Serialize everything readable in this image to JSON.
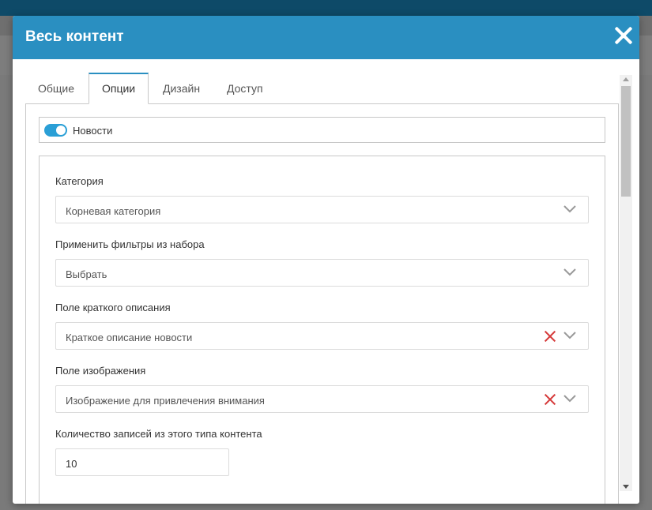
{
  "modal": {
    "title": "Весь контент"
  },
  "tabs": [
    {
      "label": "Общие",
      "active": false
    },
    {
      "label": "Опции",
      "active": true
    },
    {
      "label": "Дизайн",
      "active": false
    },
    {
      "label": "Доступ",
      "active": false
    }
  ],
  "toggle": {
    "label": "Новости",
    "checked": true
  },
  "fields": {
    "category": {
      "label": "Категория",
      "value": "Корневая категория"
    },
    "filters": {
      "label": "Применить фильтры из набора",
      "value": "Выбрать"
    },
    "summary": {
      "label": "Поле краткого описания",
      "value": "Краткое описание новости"
    },
    "image": {
      "label": "Поле изображения",
      "value": "Изображение для привлечения внимания"
    },
    "count": {
      "label": "Количество записей из этого типа контента",
      "value": "10"
    }
  },
  "colors": {
    "header": "#2a8fc1",
    "toggle_on": "#2a9fd6",
    "clear": "#d63c3c"
  }
}
